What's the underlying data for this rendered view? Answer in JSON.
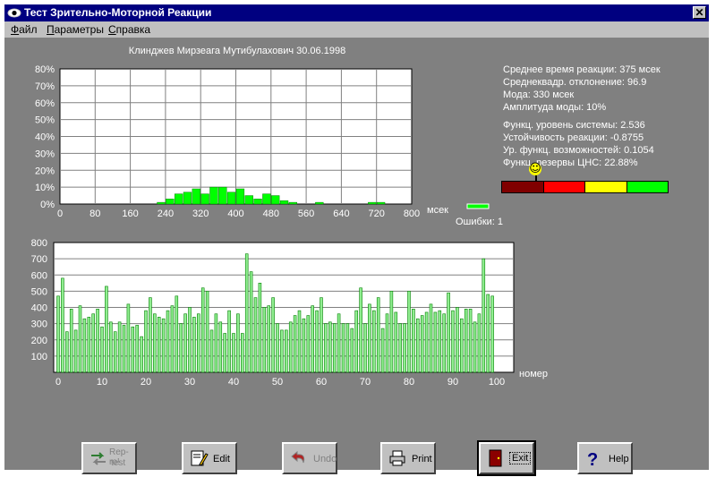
{
  "window": {
    "title": "Тест Зрительно-Моторной Реакции",
    "close_label": "✕"
  },
  "menu": [
    {
      "label": "Файл",
      "key": "Ф",
      "rest": "айл"
    },
    {
      "label": "Параметры",
      "key": "П",
      "rest": "араметры"
    },
    {
      "label": "Справка",
      "key": "С",
      "rest": "правка"
    }
  ],
  "subject": "Клинджев Мирзеага Мутибулахович 30.06.1998",
  "stats": {
    "mean": "Среднее время реакции: 375 мсек",
    "sd": "Среднеквадр. отклонение: 96.9",
    "mode": "Мода: 330 мсек",
    "amp": "Амплитуда моды: 10%",
    "fus": "Функц. уровень системы: 2.536",
    "ur": "Устойчивость реакции: -0.8755",
    "ufv": "Ур. функц. возможностей: 0.1054",
    "reserve": "Функц. резервы ЦНС: 22.88%"
  },
  "indicator": {
    "smiley": "☺",
    "segments": [
      "#800000",
      "#ff0000",
      "#ffff00",
      "#00ff00"
    ]
  },
  "buttons": {
    "rep": {
      "line1": "Rep-ro!",
      "line2": "test"
    },
    "edit": "Edit",
    "undo": "Undo",
    "print": "Print",
    "exit": "Exit",
    "help": "Help"
  },
  "chart_data": [
    {
      "type": "bar",
      "title": "",
      "xlabel": "мсек",
      "ylabel": "",
      "xlim": [
        0,
        800
      ],
      "ylim": [
        0,
        80
      ],
      "x_ticks": [
        "0",
        "80",
        "160",
        "240",
        "320",
        "400",
        "480",
        "560",
        "640",
        "720",
        "800"
      ],
      "y_ticks": [
        "0%",
        "10%",
        "20%",
        "30%",
        "40%",
        "50%",
        "60%",
        "70%",
        "80%"
      ],
      "bin_width": 20,
      "bins": [
        {
          "x": 220,
          "v": 1
        },
        {
          "x": 240,
          "v": 3
        },
        {
          "x": 260,
          "v": 6
        },
        {
          "x": 280,
          "v": 7
        },
        {
          "x": 300,
          "v": 9
        },
        {
          "x": 320,
          "v": 6
        },
        {
          "x": 340,
          "v": 10
        },
        {
          "x": 360,
          "v": 10
        },
        {
          "x": 380,
          "v": 7
        },
        {
          "x": 400,
          "v": 9
        },
        {
          "x": 420,
          "v": 5
        },
        {
          "x": 440,
          "v": 3
        },
        {
          "x": 460,
          "v": 6
        },
        {
          "x": 480,
          "v": 5
        },
        {
          "x": 500,
          "v": 2
        },
        {
          "x": 520,
          "v": 1
        },
        {
          "x": 580,
          "v": 1
        },
        {
          "x": 700,
          "v": 1
        },
        {
          "x": 720,
          "v": 1
        }
      ],
      "errors_label": "Ошибки: 1",
      "errors_value": 1
    },
    {
      "type": "bar",
      "title": "",
      "xlabel": "номер",
      "ylabel": "",
      "xlim": [
        0,
        100
      ],
      "ylim": [
        0,
        800
      ],
      "x_ticks": [
        "0",
        "10",
        "20",
        "30",
        "40",
        "50",
        "60",
        "70",
        "80",
        "90",
        "100"
      ],
      "y_ticks": [
        "100",
        "200",
        "300",
        "400",
        "500",
        "600",
        "700",
        "800"
      ],
      "values": [
        470,
        580,
        250,
        390,
        260,
        410,
        330,
        340,
        360,
        390,
        280,
        530,
        310,
        250,
        310,
        290,
        420,
        280,
        290,
        220,
        380,
        460,
        360,
        340,
        330,
        380,
        410,
        470,
        300,
        360,
        400,
        340,
        360,
        520,
        500,
        260,
        360,
        310,
        240,
        380,
        240,
        360,
        240,
        730,
        620,
        460,
        550,
        400,
        410,
        460,
        300,
        260,
        260,
        310,
        350,
        380,
        330,
        350,
        410,
        380,
        460,
        300,
        310,
        300,
        360,
        300,
        300,
        270,
        380,
        520,
        300,
        420,
        380,
        460,
        270,
        360,
        500,
        370,
        300,
        300,
        500,
        390,
        330,
        350,
        370,
        420,
        370,
        380,
        360,
        490,
        380,
        400,
        330,
        390,
        390,
        310,
        360,
        700,
        480,
        470
      ]
    }
  ]
}
